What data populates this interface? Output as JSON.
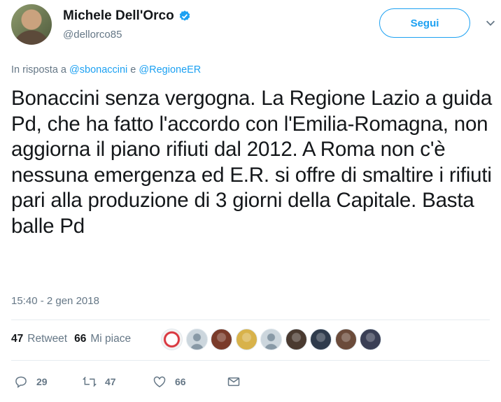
{
  "author": {
    "display_name": "Michele Dell'Orco",
    "handle": "@dellorco85",
    "follow_label": "Segui"
  },
  "reply": {
    "prefix": "In risposta a",
    "mention1": "@sbonaccini",
    "conjunction": "e",
    "mention2": "@RegioneER"
  },
  "tweet": {
    "text": "Bonaccini senza vergogna. La Regione Lazio a guida Pd, che ha fatto l'accordo con l'Emilia-Romagna, non aggiorna il piano rifiuti dal 2012. A Roma non c'è nessuna emergenza ed E.R. si offre di smaltire i rifiuti pari alla produzione di 3 giorni della Capitale. Basta balle Pd",
    "timestamp": "15:40 - 2 gen 2018"
  },
  "stats": {
    "retweets_count": "47",
    "retweets_label": "Retweet",
    "likes_count": "66",
    "likes_label": "Mi piace"
  },
  "likers": [
    {
      "icon": "m5s-logo-avatar",
      "color": "#f3f3f3"
    },
    {
      "icon": "default-avatar",
      "color": "#ccd6dd"
    },
    {
      "icon": "photo-avatar",
      "color": "#7a3b2a"
    },
    {
      "icon": "photo-avatar",
      "color": "#d8b24a"
    },
    {
      "icon": "default-avatar",
      "color": "#ccd6dd"
    },
    {
      "icon": "photo-avatar",
      "color": "#4a3a30"
    },
    {
      "icon": "photo-avatar",
      "color": "#2f3b4c"
    },
    {
      "icon": "photo-avatar",
      "color": "#6b4b3a"
    },
    {
      "icon": "photo-avatar",
      "color": "#3a3f55"
    }
  ],
  "actions": {
    "reply_count": "29",
    "retweet_count": "47",
    "like_count": "66"
  },
  "colors": {
    "accent": "#1da1f2",
    "muted": "#657786",
    "text": "#14171a"
  }
}
